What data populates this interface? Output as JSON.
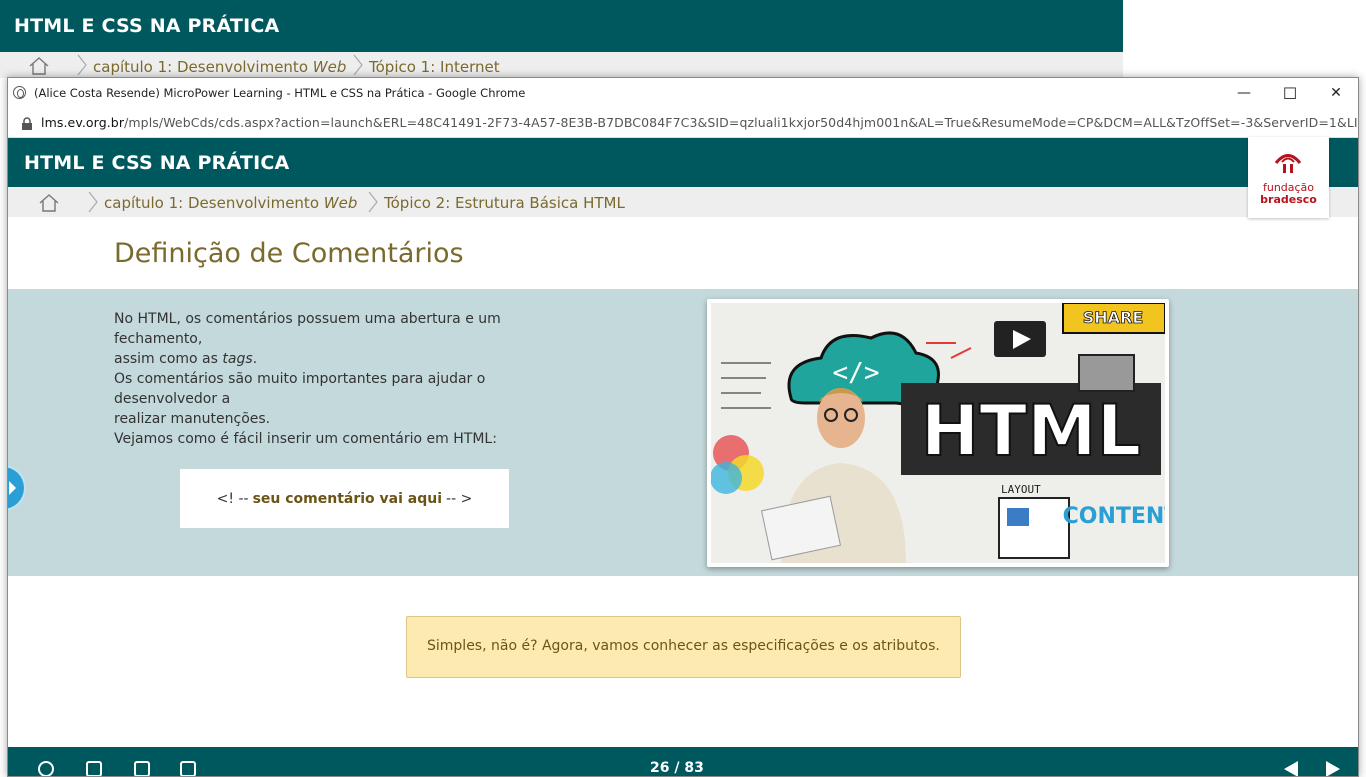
{
  "background_window": {
    "course_title": "HTML E CSS NA PRÁTICA",
    "breadcrumb": {
      "chapter_prefix": "capítulo 1: Desenvolvimento ",
      "chapter_em": "Web",
      "topic": "Tópico 1: Internet"
    }
  },
  "browser": {
    "window_title": "(Alice Costa Resende) MicroPower Learning - HTML e CSS na Prática - Google Chrome",
    "controls": {
      "minimize": "—",
      "maximize": "☐",
      "close": "✕"
    },
    "url_domain": "lms.ev.org.br",
    "url_path": "/mpls/WebCds/cds.aspx?action=launch&ERL=48C41491-2F73-4A57-8E3B-B7DBC084F7C3&SID=qzluali1kxjor50d4hjm001n&AL=True&ResumeMode=CP&DCM=ALL&TzOffSet=-3&ServerID=1&LI..."
  },
  "app": {
    "course_title": "HTML E CSS NA PRÁTICA",
    "logo": {
      "line1": "fundação",
      "line2": "bradesco"
    },
    "breadcrumb": {
      "chapter_prefix": "capítulo 1: Desenvolvimento ",
      "chapter_em": "Web",
      "topic": "Tópico 2: Estrutura Básica HTML"
    },
    "page_title": "Definição de Comentários",
    "content": {
      "p1_a": "No HTML, os comentários possuem uma abertura e um fechamento,",
      "p1_b": "assim como as ",
      "p1_em": "tags",
      "p1_c": ".",
      "p2_a": "Os comentários são muito importantes para ajudar o desenvolvedor a",
      "p2_b": "realizar manutenções.",
      "p3": "Vejamos como é fácil inserir um comentário em HTML:",
      "code_open": "<! --",
      "code_highlight": "seu comentário vai aqui",
      "code_close": "-- >"
    },
    "image": {
      "big_word": "HTML",
      "content_word": "CONTENT",
      "layout_word": "LAYOUT",
      "share_word": "SHARE",
      "code_tag": "</>"
    },
    "note": "Simples, não é? Agora, vamos conhecer as especificações e os atributos.",
    "footer": {
      "counter": "26 / 83"
    },
    "colors": {
      "header": "#00585f",
      "band": "#c3d9db",
      "note_bg": "#fdeab1",
      "accent_text": "#7a6a2d"
    }
  }
}
